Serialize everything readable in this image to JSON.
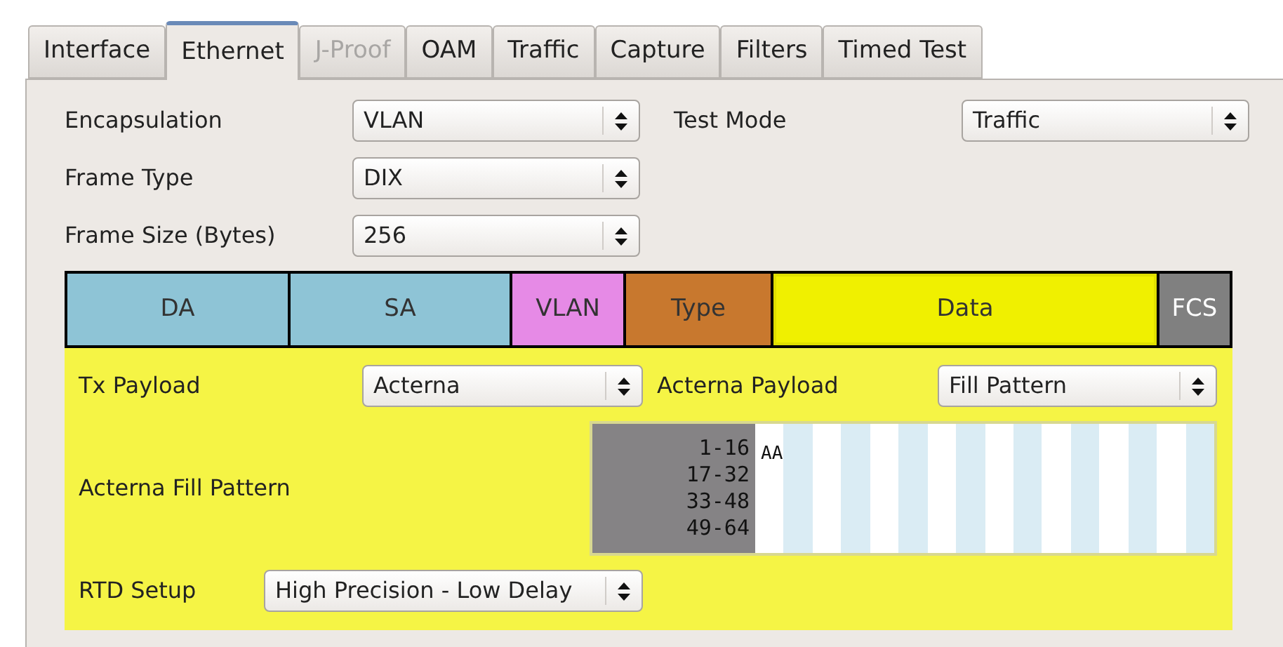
{
  "tabs": [
    {
      "label": "Interface",
      "selected": false,
      "disabled": false
    },
    {
      "label": "Ethernet",
      "selected": true,
      "disabled": false
    },
    {
      "label": "J-Proof",
      "selected": false,
      "disabled": true
    },
    {
      "label": "OAM",
      "selected": false,
      "disabled": false
    },
    {
      "label": "Traffic",
      "selected": false,
      "disabled": false
    },
    {
      "label": "Capture",
      "selected": false,
      "disabled": false
    },
    {
      "label": "Filters",
      "selected": false,
      "disabled": false
    },
    {
      "label": "Timed Test",
      "selected": false,
      "disabled": false
    }
  ],
  "settings": {
    "encapsulation": {
      "label": "Encapsulation",
      "value": "VLAN"
    },
    "test_mode": {
      "label": "Test Mode",
      "value": "Traffic"
    },
    "frame_type": {
      "label": "Frame Type",
      "value": "DIX"
    },
    "frame_size": {
      "label": "Frame Size (Bytes)",
      "value": "256"
    }
  },
  "frame_fields": [
    {
      "label": "DA",
      "color": "#8ec4d6",
      "selected": false
    },
    {
      "label": "SA",
      "color": "#8ec4d6",
      "selected": false
    },
    {
      "label": "VLAN",
      "color": "#e68ae6",
      "selected": false
    },
    {
      "label": "Type",
      "color": "#c8782e",
      "selected": false
    },
    {
      "label": "Data",
      "color": "#f0f000",
      "selected": true
    },
    {
      "label": "FCS",
      "color": "#808080",
      "selected": false
    }
  ],
  "data_panel": {
    "tx_payload": {
      "label": "Tx Payload",
      "value": "Acterna"
    },
    "acterna_payload": {
      "label": "Acterna Payload",
      "value": "Fill Pattern"
    },
    "fill_pattern": {
      "label": "Acterna Fill Pattern",
      "rows": [
        {
          "range": "1-16",
          "bytes": "AA"
        },
        {
          "range": "17-32"
        },
        {
          "range": "33-48"
        },
        {
          "range": "49-64"
        }
      ]
    },
    "rtd_setup": {
      "label": "RTD Setup",
      "value": "High Precision - Low Delay"
    }
  }
}
